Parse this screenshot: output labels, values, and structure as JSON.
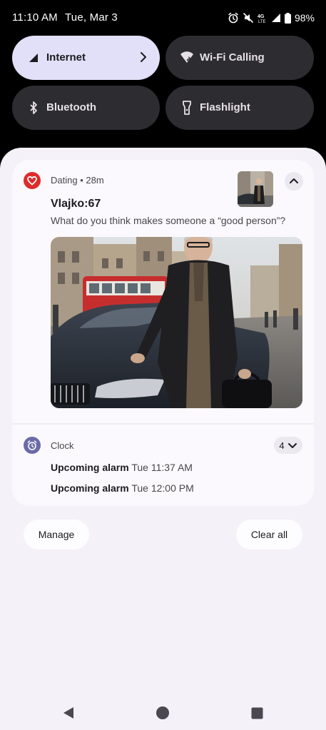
{
  "status_bar": {
    "time": "11:10 AM",
    "date": "Tue, Mar 3",
    "battery": "98%",
    "icons": [
      "alarm-icon",
      "mute-icon",
      "lte-icon",
      "signal-icon",
      "battery-icon"
    ]
  },
  "quick_settings": {
    "tiles": [
      {
        "label": "Internet",
        "icon": "cellular-icon",
        "active": true,
        "has_chevron": true
      },
      {
        "label": "Wi-Fi Calling",
        "icon": "wifi-calling-icon",
        "active": false
      },
      {
        "label": "Bluetooth",
        "icon": "bluetooth-icon",
        "active": false
      },
      {
        "label": "Flashlight",
        "icon": "flashlight-icon",
        "active": false
      }
    ]
  },
  "notifications": {
    "dating": {
      "app_line": "Dating • 28m",
      "sender": "Vlajko:67",
      "message": "What do you think makes someone a “good person”?",
      "icon": "heart-icon",
      "color": "#e02b2b"
    },
    "clock": {
      "app_name": "Clock",
      "count": "4",
      "icon": "alarm-clock-icon",
      "color": "#6b6aa8",
      "alarms": [
        {
          "title": "Upcoming alarm",
          "time": "Tue 11:37 AM"
        },
        {
          "title": "Upcoming alarm",
          "time": "Tue 12:00 PM"
        }
      ]
    }
  },
  "actions": {
    "manage": "Manage",
    "clear_all": "Clear all"
  },
  "nav": {
    "buttons": [
      "back-icon",
      "home-icon",
      "recents-icon"
    ]
  }
}
